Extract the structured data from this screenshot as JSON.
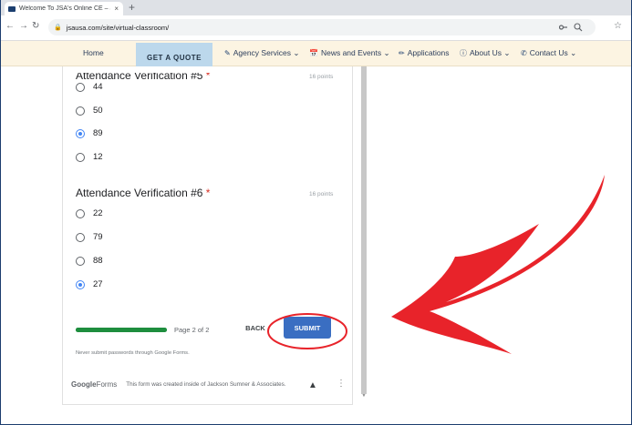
{
  "browser": {
    "tab_title": "Welcome To JSA's Online CE – Jo",
    "tab_close": "×",
    "new_tab": "+",
    "url": "jsausa.com/site/virtual-classroom/"
  },
  "site_nav": {
    "home": "Home",
    "get_quote": "GET A QUOTE",
    "agency_services": "Agency Services",
    "news_events": "News and Events",
    "applications": "Applications",
    "about_us": "About Us",
    "contact_us": "Contact Us"
  },
  "form": {
    "q5": {
      "title": "Attendance Verification #5",
      "required": "*",
      "points": "16 points",
      "options": [
        "44",
        "50",
        "89",
        "12"
      ],
      "selected": "89"
    },
    "q6": {
      "title": "Attendance Verification #6",
      "required": "*",
      "points": "16 points",
      "options": [
        "22",
        "79",
        "88",
        "27"
      ],
      "selected": "27"
    },
    "progress": 1.0,
    "page_label": "Page 2 of 2",
    "back_label": "BACK",
    "submit_label": "SUBMIT",
    "warning": "Never submit passwords through Google Forms.",
    "footer_brand_bold": "Google",
    "footer_brand_rest": "Forms",
    "footer_text": "This form was created inside of Jackson Sumner & Associates."
  },
  "annotation": {
    "color": "#e8232a"
  }
}
